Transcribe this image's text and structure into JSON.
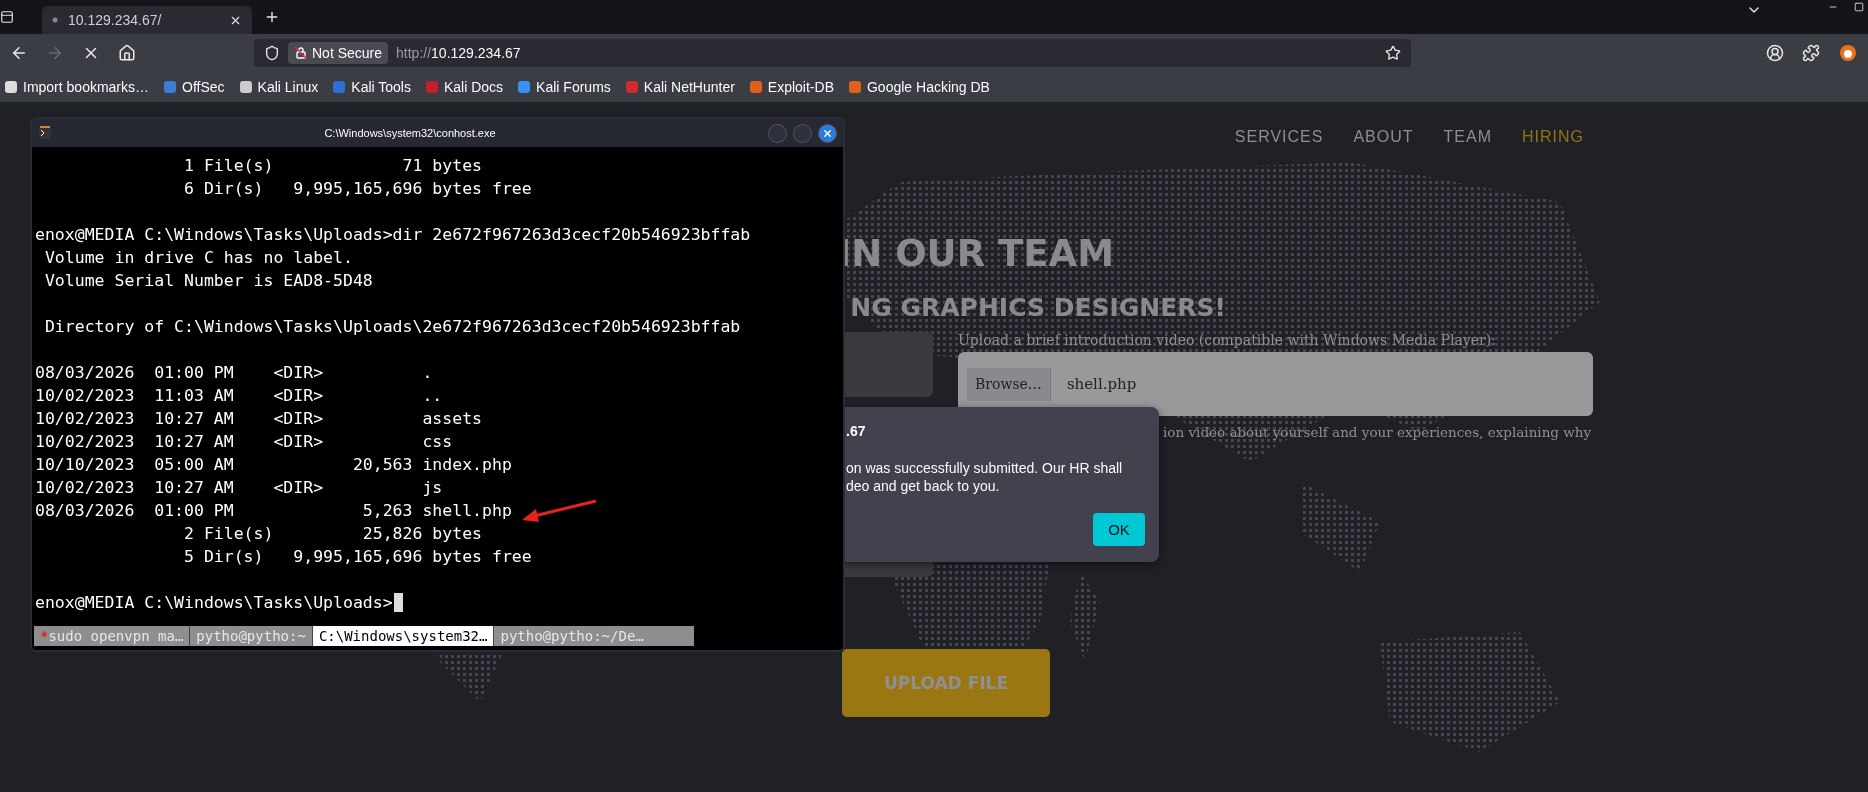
{
  "browser": {
    "tabs": [
      {
        "title": "10.129.234.67/",
        "selected": true
      }
    ],
    "buttons": [
      {
        "kind": "back",
        "disabled": false
      },
      {
        "kind": "forward",
        "disabled": true
      },
      {
        "kind": "stop",
        "disabled": false
      },
      {
        "kind": "home",
        "disabled": false
      }
    ],
    "security_label": "Not Secure",
    "url_scheme": "http://",
    "url_host": "10.129.234.67",
    "bookmarks": [
      {
        "kind": "import",
        "label": "Import bookmarks…"
      },
      {
        "kind": "offsec",
        "label": "OffSec"
      },
      {
        "kind": "kali",
        "label": "Kali Linux"
      },
      {
        "kind": "tools",
        "label": "Kali Tools"
      },
      {
        "kind": "docs",
        "label": "Kali Docs"
      },
      {
        "kind": "forums",
        "label": "Kali Forums"
      },
      {
        "kind": "nethunter",
        "label": "Kali NetHunter"
      },
      {
        "kind": "exploit",
        "label": "Exploit-DB"
      },
      {
        "kind": "exploit",
        "label": "Google Hacking DB"
      }
    ]
  },
  "site": {
    "nav": [
      {
        "label": "SERVICES",
        "selected": false
      },
      {
        "label": "ABOUT",
        "selected": false
      },
      {
        "label": "TEAM",
        "selected": false
      },
      {
        "label": "HIRING",
        "selected": true
      }
    ],
    "title": "IN OUR TEAM",
    "subtitle": "NG GRAPHICS DESIGNERS!",
    "upload_label": "Upload a brief introduction video (compatible with Windows Media Player):",
    "file_button": "Browse…",
    "file_name": "shell.php",
    "description": "ion video about yourself and your experiences, explaining why",
    "submit": "UPLOAD FILE"
  },
  "dialog": {
    "origin": ".67",
    "message_lines": [
      "on was successfully submitted. Our HR shall",
      "deo and get back to you."
    ],
    "button": "OK"
  },
  "terminal": {
    "title": "C:\\Windows\\system32\\conhost.exe",
    "lines": [
      {
        "kind": "text",
        "text": "               1 File(s)             71 bytes"
      },
      {
        "kind": "text",
        "text": "               6 Dir(s)   9,995,165,696 bytes free"
      },
      {
        "kind": "blank"
      },
      {
        "kind": "text",
        "text": "enox@MEDIA C:\\Windows\\Tasks\\Uploads>dir 2e672f967263d3cecf20b546923bffab"
      },
      {
        "kind": "text",
        "text": " Volume in drive C has no label."
      },
      {
        "kind": "text",
        "text": " Volume Serial Number is EAD8-5D48"
      },
      {
        "kind": "blank"
      },
      {
        "kind": "text",
        "text": " Directory of C:\\Windows\\Tasks\\Uploads\\2e672f967263d3cecf20b546923bffab"
      },
      {
        "kind": "blank"
      },
      {
        "kind": "text",
        "text": "08/03/2026  01:00 PM    <DIR>          ."
      },
      {
        "kind": "text",
        "text": "10/02/2023  11:03 AM    <DIR>          .."
      },
      {
        "kind": "text",
        "text": "10/02/2023  10:27 AM    <DIR>          assets"
      },
      {
        "kind": "text",
        "text": "10/02/2023  10:27 AM    <DIR>          css"
      },
      {
        "kind": "text",
        "text": "10/10/2023  05:00 AM            20,563 index.php"
      },
      {
        "kind": "text",
        "text": "10/02/2023  10:27 AM    <DIR>          js"
      },
      {
        "kind": "marked",
        "text": "08/03/2026  01:00 PM             5,263 shell.php"
      },
      {
        "kind": "text",
        "text": "               2 File(s)         25,826 bytes"
      },
      {
        "kind": "text",
        "text": "               5 Dir(s)   9,995,165,696 bytes free"
      },
      {
        "kind": "blank"
      },
      {
        "kind": "prompt",
        "text": "enox@MEDIA C:\\Windows\\Tasks\\Uploads>"
      }
    ],
    "tabs": [
      {
        "marker": "*",
        "label": "sudo openvpn ma…",
        "selected": false
      },
      {
        "label": "pytho@pytho:~",
        "selected": false
      },
      {
        "label": "C:\\Windows\\system32…",
        "selected": true
      },
      {
        "label": "pytho@pytho:~/De…",
        "selected": false
      }
    ]
  }
}
